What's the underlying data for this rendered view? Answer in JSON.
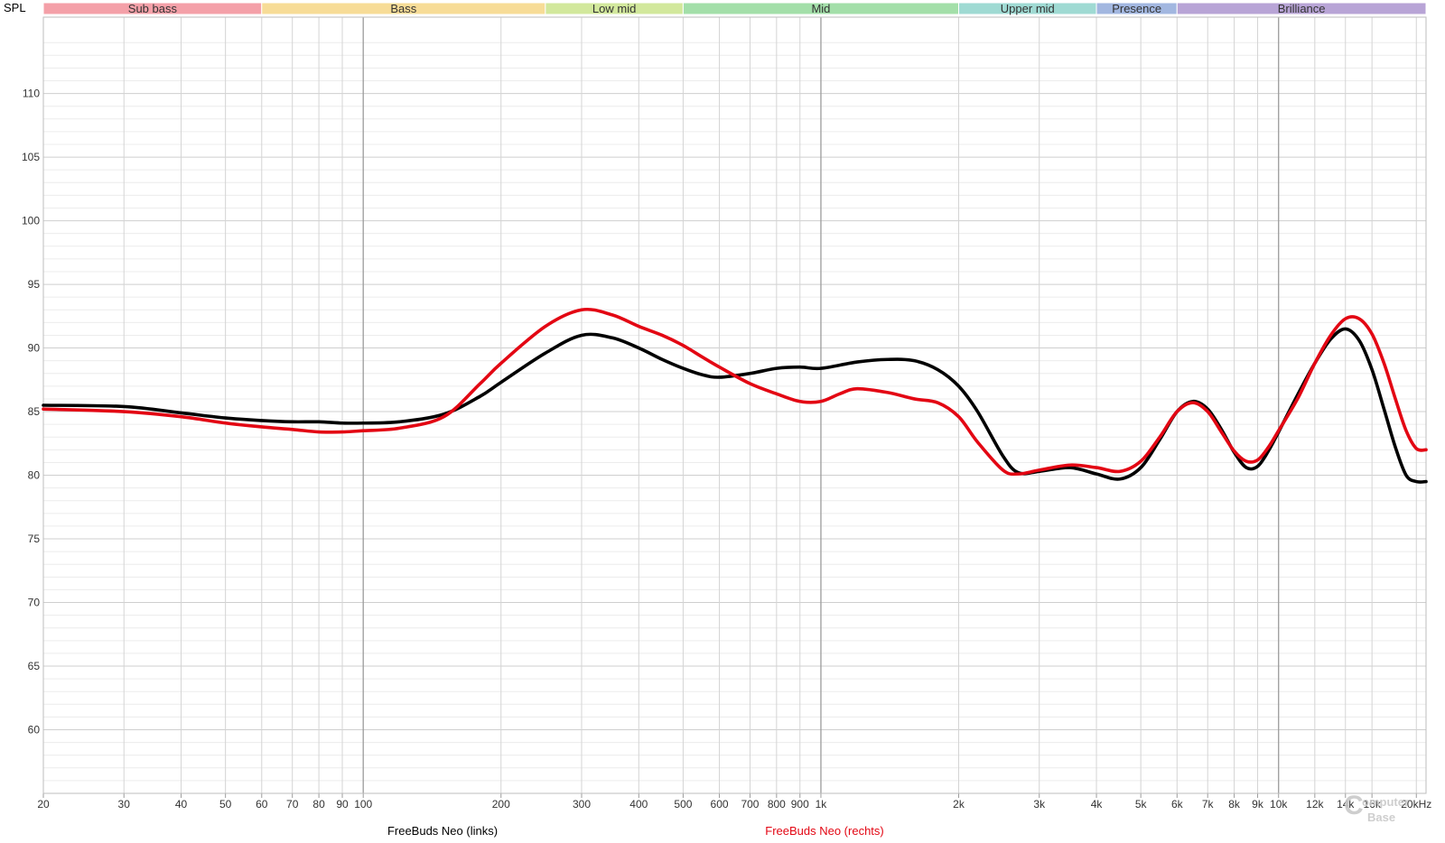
{
  "chart_data": {
    "type": "line",
    "ylabel": "SPL",
    "xlabel": "",
    "xscale": "log",
    "xlim": [
      20,
      21000
    ],
    "ylim": [
      55,
      116
    ],
    "grid": true,
    "y_ticks": [
      "60",
      "65",
      "70",
      "75",
      "80",
      "85",
      "90",
      "95",
      "100",
      "105",
      "110"
    ],
    "x_ticks": [
      {
        "v": 20,
        "label": "20"
      },
      {
        "v": 30,
        "label": "30"
      },
      {
        "v": 40,
        "label": "40"
      },
      {
        "v": 50,
        "label": "50"
      },
      {
        "v": 60,
        "label": "60"
      },
      {
        "v": 70,
        "label": "70"
      },
      {
        "v": 80,
        "label": "80"
      },
      {
        "v": 90,
        "label": "90"
      },
      {
        "v": 100,
        "label": "100"
      },
      {
        "v": 200,
        "label": "200"
      },
      {
        "v": 300,
        "label": "300"
      },
      {
        "v": 400,
        "label": "400"
      },
      {
        "v": 500,
        "label": "500"
      },
      {
        "v": 600,
        "label": "600"
      },
      {
        "v": 700,
        "label": "700"
      },
      {
        "v": 800,
        "label": "800"
      },
      {
        "v": 900,
        "label": "900"
      },
      {
        "v": 1000,
        "label": "1k"
      },
      {
        "v": 2000,
        "label": "2k"
      },
      {
        "v": 3000,
        "label": "3k"
      },
      {
        "v": 4000,
        "label": "4k"
      },
      {
        "v": 5000,
        "label": "5k"
      },
      {
        "v": 6000,
        "label": "6k"
      },
      {
        "v": 7000,
        "label": "7k"
      },
      {
        "v": 8000,
        "label": "8k"
      },
      {
        "v": 9000,
        "label": "9k"
      },
      {
        "v": 10000,
        "label": "10k"
      },
      {
        "v": 12000,
        "label": "12k"
      },
      {
        "v": 14000,
        "label": "14k"
      },
      {
        "v": 16000,
        "label": "16k"
      },
      {
        "v": 20000,
        "label": "20kHz"
      }
    ],
    "bands": [
      {
        "name": "Sub bass",
        "from": 20,
        "to": 60,
        "color": "#f4a0a8"
      },
      {
        "name": "Bass",
        "from": 60,
        "to": 250,
        "color": "#f7dc97"
      },
      {
        "name": "Low mid",
        "from": 250,
        "to": 500,
        "color": "#d2e89c"
      },
      {
        "name": "Mid",
        "from": 500,
        "to": 2000,
        "color": "#a3dfa9"
      },
      {
        "name": "Upper mid",
        "from": 2000,
        "to": 4000,
        "color": "#9fdad3"
      },
      {
        "name": "Presence",
        "from": 4000,
        "to": 6000,
        "color": "#a2b7e0"
      },
      {
        "name": "Brilliance",
        "from": 6000,
        "to": 21000,
        "color": "#b8a4d6"
      }
    ],
    "series": [
      {
        "name": "FreeBuds Neo (links)",
        "color": "#000000",
        "x": [
          20,
          30,
          40,
          50,
          60,
          70,
          80,
          90,
          100,
          120,
          150,
          180,
          200,
          250,
          300,
          350,
          400,
          450,
          500,
          550,
          600,
          700,
          800,
          900,
          1000,
          1200,
          1400,
          1600,
          1800,
          2000,
          2200,
          2500,
          2700,
          3000,
          3500,
          4000,
          4500,
          5000,
          5500,
          6000,
          6500,
          7000,
          7500,
          8000,
          8500,
          9000,
          9500,
          10000,
          11000,
          12000,
          13000,
          14000,
          15000,
          16000,
          17000,
          18000,
          19000,
          20000,
          21000
        ],
        "y": [
          85.5,
          85.4,
          84.9,
          84.5,
          84.3,
          84.2,
          84.2,
          84.1,
          84.1,
          84.2,
          84.8,
          86.2,
          87.3,
          89.6,
          91.0,
          90.8,
          90.0,
          89.1,
          88.4,
          87.9,
          87.7,
          88.0,
          88.4,
          88.5,
          88.4,
          88.9,
          89.1,
          89.0,
          88.3,
          87.0,
          85.0,
          81.5,
          80.2,
          80.3,
          80.6,
          80.1,
          79.7,
          80.6,
          82.8,
          85.0,
          85.8,
          85.2,
          83.6,
          81.8,
          80.6,
          80.7,
          81.9,
          83.4,
          86.3,
          88.8,
          90.7,
          91.5,
          90.6,
          88.3,
          85.2,
          82.2,
          80.0,
          79.5,
          79.5
        ]
      },
      {
        "name": "FreeBuds Neo (rechts)",
        "color": "#e30613",
        "x": [
          20,
          30,
          40,
          50,
          60,
          70,
          80,
          90,
          100,
          120,
          150,
          180,
          200,
          250,
          300,
          350,
          400,
          450,
          500,
          550,
          600,
          700,
          800,
          900,
          1000,
          1100,
          1200,
          1400,
          1600,
          1800,
          2000,
          2200,
          2500,
          2700,
          3000,
          3500,
          4000,
          4500,
          5000,
          5500,
          6000,
          6500,
          7000,
          7500,
          8000,
          8500,
          9000,
          9500,
          10000,
          11000,
          12000,
          13000,
          14000,
          15000,
          16000,
          17000,
          18000,
          19000,
          20000,
          21000
        ],
        "y": [
          85.2,
          85.0,
          84.6,
          84.1,
          83.8,
          83.6,
          83.4,
          83.4,
          83.5,
          83.7,
          84.6,
          87.2,
          88.8,
          91.7,
          93.0,
          92.6,
          91.7,
          91.0,
          90.2,
          89.3,
          88.5,
          87.2,
          86.4,
          85.8,
          85.8,
          86.4,
          86.8,
          86.5,
          86.0,
          85.7,
          84.6,
          82.6,
          80.4,
          80.1,
          80.4,
          80.8,
          80.6,
          80.3,
          81.1,
          83.0,
          85.0,
          85.7,
          85.0,
          83.4,
          81.9,
          81.1,
          81.2,
          82.2,
          83.5,
          86.0,
          88.8,
          91.0,
          92.3,
          92.3,
          91.1,
          88.8,
          86.0,
          83.5,
          82.1,
          82.0
        ]
      }
    ],
    "watermark": "ComputerBase"
  }
}
